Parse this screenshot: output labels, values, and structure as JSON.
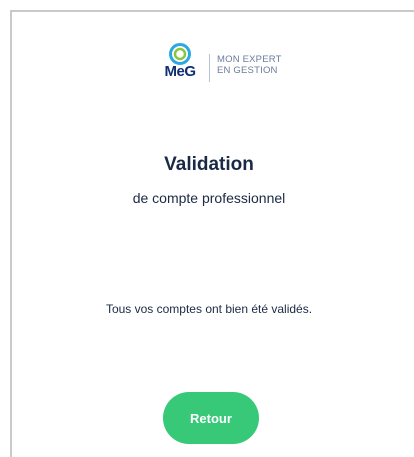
{
  "logo": {
    "brand": "MeG",
    "tagline_line1": "MON EXPERT",
    "tagline_line2": "EN GESTION",
    "ring_color_outer": "#2aa9e0",
    "ring_color_inner": "#8bc63e"
  },
  "main": {
    "title": "Validation",
    "subtitle": "de compte professionnel",
    "message": "Tous vos comptes ont bien été validés."
  },
  "actions": {
    "back_label": "Retour"
  },
  "colors": {
    "button": "#37c878",
    "text": "#1a2a44",
    "brand": "#0f2f6e"
  }
}
